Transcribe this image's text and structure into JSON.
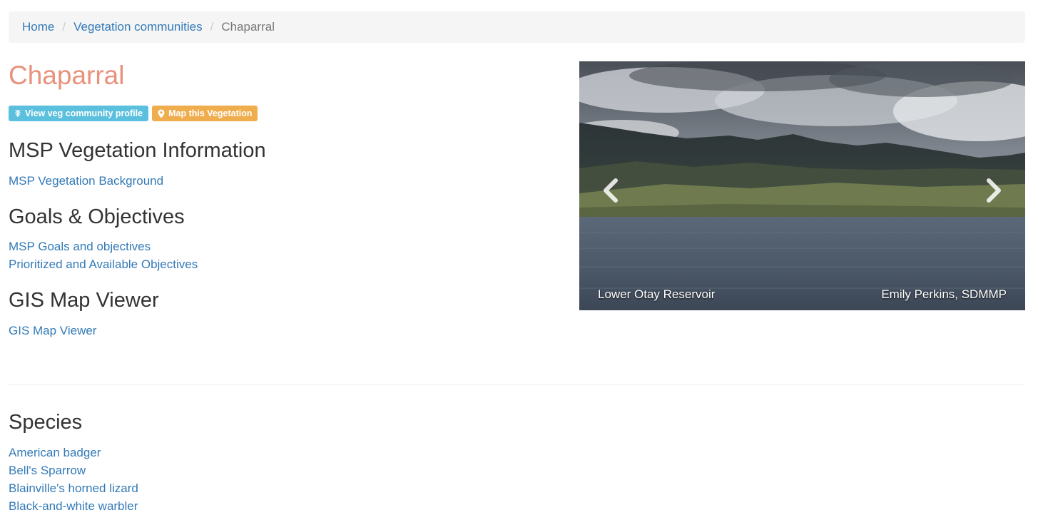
{
  "breadcrumb": {
    "items": [
      "Home",
      "Vegetation communities"
    ],
    "separator": "/",
    "current": "Chaparral"
  },
  "page": {
    "title": "Chaparral"
  },
  "badges": {
    "profile": {
      "label": "View veg community profile",
      "icon": "plant-icon",
      "color": "#5bc0de"
    },
    "map": {
      "label": "Map this Vegetation",
      "icon": "map-marker-icon",
      "color": "#f0ad4e"
    }
  },
  "sections": {
    "msp_info": {
      "heading": "MSP Vegetation Information",
      "links": [
        "MSP Vegetation Background"
      ]
    },
    "goals": {
      "heading": "Goals & Objectives",
      "links": [
        "MSP Goals and objectives",
        "Prioritized and Available Objectives"
      ]
    },
    "gis": {
      "heading": "GIS Map Viewer",
      "links": [
        "GIS Map Viewer"
      ]
    },
    "species": {
      "heading": "Species",
      "links": [
        "American badger",
        "Bell's Sparrow",
        "Blainville's horned lizard",
        "Black-and-white warbler"
      ]
    }
  },
  "carousel": {
    "caption_location": "Lower Otay Reservoir",
    "caption_credit": "Emily Perkins, SDMMP",
    "prev_icon": "chevron-left-icon",
    "next_icon": "chevron-right-icon"
  },
  "colors": {
    "title": "#e8927c",
    "link": "#337ab7",
    "breadcrumb_bg": "#f5f5f5"
  }
}
